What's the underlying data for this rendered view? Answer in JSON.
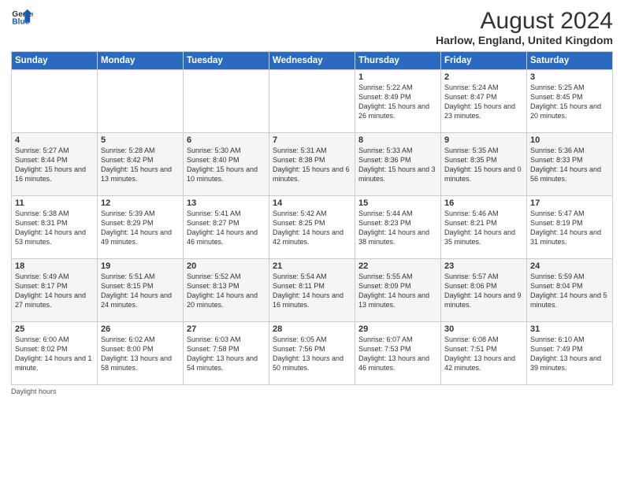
{
  "header": {
    "logo_general": "General",
    "logo_blue": "Blue",
    "month_year": "August 2024",
    "location": "Harlow, England, United Kingdom"
  },
  "days_of_week": [
    "Sunday",
    "Monday",
    "Tuesday",
    "Wednesday",
    "Thursday",
    "Friday",
    "Saturday"
  ],
  "footer": {
    "daylight_hours": "Daylight hours"
  },
  "weeks": [
    [
      {
        "date": "",
        "sunrise": "",
        "sunset": "",
        "daylight": ""
      },
      {
        "date": "",
        "sunrise": "",
        "sunset": "",
        "daylight": ""
      },
      {
        "date": "",
        "sunrise": "",
        "sunset": "",
        "daylight": ""
      },
      {
        "date": "",
        "sunrise": "",
        "sunset": "",
        "daylight": ""
      },
      {
        "date": "1",
        "sunrise": "Sunrise: 5:22 AM",
        "sunset": "Sunset: 8:49 PM",
        "daylight": "Daylight: 15 hours and 26 minutes."
      },
      {
        "date": "2",
        "sunrise": "Sunrise: 5:24 AM",
        "sunset": "Sunset: 8:47 PM",
        "daylight": "Daylight: 15 hours and 23 minutes."
      },
      {
        "date": "3",
        "sunrise": "Sunrise: 5:25 AM",
        "sunset": "Sunset: 8:45 PM",
        "daylight": "Daylight: 15 hours and 20 minutes."
      }
    ],
    [
      {
        "date": "4",
        "sunrise": "Sunrise: 5:27 AM",
        "sunset": "Sunset: 8:44 PM",
        "daylight": "Daylight: 15 hours and 16 minutes."
      },
      {
        "date": "5",
        "sunrise": "Sunrise: 5:28 AM",
        "sunset": "Sunset: 8:42 PM",
        "daylight": "Daylight: 15 hours and 13 minutes."
      },
      {
        "date": "6",
        "sunrise": "Sunrise: 5:30 AM",
        "sunset": "Sunset: 8:40 PM",
        "daylight": "Daylight: 15 hours and 10 minutes."
      },
      {
        "date": "7",
        "sunrise": "Sunrise: 5:31 AM",
        "sunset": "Sunset: 8:38 PM",
        "daylight": "Daylight: 15 hours and 6 minutes."
      },
      {
        "date": "8",
        "sunrise": "Sunrise: 5:33 AM",
        "sunset": "Sunset: 8:36 PM",
        "daylight": "Daylight: 15 hours and 3 minutes."
      },
      {
        "date": "9",
        "sunrise": "Sunrise: 5:35 AM",
        "sunset": "Sunset: 8:35 PM",
        "daylight": "Daylight: 15 hours and 0 minutes."
      },
      {
        "date": "10",
        "sunrise": "Sunrise: 5:36 AM",
        "sunset": "Sunset: 8:33 PM",
        "daylight": "Daylight: 14 hours and 56 minutes."
      }
    ],
    [
      {
        "date": "11",
        "sunrise": "Sunrise: 5:38 AM",
        "sunset": "Sunset: 8:31 PM",
        "daylight": "Daylight: 14 hours and 53 minutes."
      },
      {
        "date": "12",
        "sunrise": "Sunrise: 5:39 AM",
        "sunset": "Sunset: 8:29 PM",
        "daylight": "Daylight: 14 hours and 49 minutes."
      },
      {
        "date": "13",
        "sunrise": "Sunrise: 5:41 AM",
        "sunset": "Sunset: 8:27 PM",
        "daylight": "Daylight: 14 hours and 46 minutes."
      },
      {
        "date": "14",
        "sunrise": "Sunrise: 5:42 AM",
        "sunset": "Sunset: 8:25 PM",
        "daylight": "Daylight: 14 hours and 42 minutes."
      },
      {
        "date": "15",
        "sunrise": "Sunrise: 5:44 AM",
        "sunset": "Sunset: 8:23 PM",
        "daylight": "Daylight: 14 hours and 38 minutes."
      },
      {
        "date": "16",
        "sunrise": "Sunrise: 5:46 AM",
        "sunset": "Sunset: 8:21 PM",
        "daylight": "Daylight: 14 hours and 35 minutes."
      },
      {
        "date": "17",
        "sunrise": "Sunrise: 5:47 AM",
        "sunset": "Sunset: 8:19 PM",
        "daylight": "Daylight: 14 hours and 31 minutes."
      }
    ],
    [
      {
        "date": "18",
        "sunrise": "Sunrise: 5:49 AM",
        "sunset": "Sunset: 8:17 PM",
        "daylight": "Daylight: 14 hours and 27 minutes."
      },
      {
        "date": "19",
        "sunrise": "Sunrise: 5:51 AM",
        "sunset": "Sunset: 8:15 PM",
        "daylight": "Daylight: 14 hours and 24 minutes."
      },
      {
        "date": "20",
        "sunrise": "Sunrise: 5:52 AM",
        "sunset": "Sunset: 8:13 PM",
        "daylight": "Daylight: 14 hours and 20 minutes."
      },
      {
        "date": "21",
        "sunrise": "Sunrise: 5:54 AM",
        "sunset": "Sunset: 8:11 PM",
        "daylight": "Daylight: 14 hours and 16 minutes."
      },
      {
        "date": "22",
        "sunrise": "Sunrise: 5:55 AM",
        "sunset": "Sunset: 8:09 PM",
        "daylight": "Daylight: 14 hours and 13 minutes."
      },
      {
        "date": "23",
        "sunrise": "Sunrise: 5:57 AM",
        "sunset": "Sunset: 8:06 PM",
        "daylight": "Daylight: 14 hours and 9 minutes."
      },
      {
        "date": "24",
        "sunrise": "Sunrise: 5:59 AM",
        "sunset": "Sunset: 8:04 PM",
        "daylight": "Daylight: 14 hours and 5 minutes."
      }
    ],
    [
      {
        "date": "25",
        "sunrise": "Sunrise: 6:00 AM",
        "sunset": "Sunset: 8:02 PM",
        "daylight": "Daylight: 14 hours and 1 minute."
      },
      {
        "date": "26",
        "sunrise": "Sunrise: 6:02 AM",
        "sunset": "Sunset: 8:00 PM",
        "daylight": "Daylight: 13 hours and 58 minutes."
      },
      {
        "date": "27",
        "sunrise": "Sunrise: 6:03 AM",
        "sunset": "Sunset: 7:58 PM",
        "daylight": "Daylight: 13 hours and 54 minutes."
      },
      {
        "date": "28",
        "sunrise": "Sunrise: 6:05 AM",
        "sunset": "Sunset: 7:56 PM",
        "daylight": "Daylight: 13 hours and 50 minutes."
      },
      {
        "date": "29",
        "sunrise": "Sunrise: 6:07 AM",
        "sunset": "Sunset: 7:53 PM",
        "daylight": "Daylight: 13 hours and 46 minutes."
      },
      {
        "date": "30",
        "sunrise": "Sunrise: 6:08 AM",
        "sunset": "Sunset: 7:51 PM",
        "daylight": "Daylight: 13 hours and 42 minutes."
      },
      {
        "date": "31",
        "sunrise": "Sunrise: 6:10 AM",
        "sunset": "Sunset: 7:49 PM",
        "daylight": "Daylight: 13 hours and 39 minutes."
      }
    ]
  ]
}
